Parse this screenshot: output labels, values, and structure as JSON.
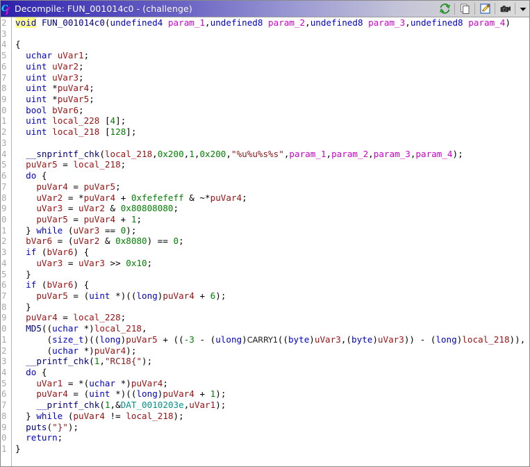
{
  "window": {
    "title": "Decompile: FUN_001014c0 - (challenge)",
    "app_icon": "ghidra-function-icon"
  },
  "toolbar": {
    "buttons": [
      {
        "name": "refresh-button",
        "icon": "refresh-icon",
        "tooltip": "Refresh"
      },
      {
        "name": "copy-button",
        "icon": "copy-icon",
        "tooltip": "Copy"
      },
      {
        "name": "edit-button",
        "icon": "edit-pencil-icon",
        "tooltip": "Edit"
      },
      {
        "name": "snapshot-button",
        "icon": "camera-icon",
        "tooltip": "Snapshot"
      },
      {
        "name": "overflow-button",
        "icon": "chevron-down-icon",
        "tooltip": "More"
      }
    ]
  },
  "colors": {
    "keyword": "#0000c8",
    "function": "#00007f",
    "variable": "#9b1010",
    "parameter": "#cc00cc",
    "number": "#008000",
    "string": "#8b1a1a",
    "data_label": "#00918c",
    "gutter_text": "#a8a8a8",
    "highlight": "#ffff8c",
    "caret": "#e00000",
    "titlebar_start": "#2b1fa8",
    "titlebar_end": "#dcdcdc"
  },
  "editor": {
    "first_line_number": 2,
    "line_count": 41,
    "gutter_digits_visible": 1,
    "line_numbers": [
      "2",
      "3",
      "4",
      "5",
      "6",
      "7",
      "8",
      "9",
      "0",
      "1",
      "2",
      "3",
      "4",
      "5",
      "6",
      "7",
      "8",
      "9",
      "0",
      "1",
      "2",
      "3",
      "4",
      "5",
      "6",
      "7",
      "8",
      "9",
      "0",
      "1",
      "2",
      "3",
      "4",
      "5",
      "6",
      "7",
      "8",
      "9",
      "0",
      "1",
      ""
    ],
    "code_lines": [
      "void FUN_001014c0(undefined4 param_1,undefined8 param_2,undefined8 param_3,undefined8 param_4)",
      "",
      "{",
      "  uchar uVar1;",
      "  uint uVar2;",
      "  uint uVar3;",
      "  uint *puVar4;",
      "  uint *puVar5;",
      "  bool bVar6;",
      "  uint local_228 [4];",
      "  uint local_218 [128];",
      "",
      "  __snprintf_chk(local_218,0x200,1,0x200,\"%u%u%s%s\",param_1,param_2,param_3,param_4);",
      "  puVar5 = local_218;",
      "  do {",
      "    puVar4 = puVar5;",
      "    uVar2 = *puVar4 + 0xfefefeff & ~*puVar4;",
      "    uVar3 = uVar2 & 0x80808080;",
      "    puVar5 = puVar4 + 1;",
      "  } while (uVar3 == 0);",
      "  bVar6 = (uVar2 & 0x8080) == 0;",
      "  if (bVar6) {",
      "    uVar3 = uVar3 >> 0x10;",
      "  }",
      "  if (bVar6) {",
      "    puVar5 = (uint *)((long)puVar4 + 6);",
      "  }",
      "  puVar4 = local_228;",
      "  MD5((uchar *)local_218,",
      "      (size_t)((long)puVar5 + ((-3 - (ulong)CARRY1((byte)uVar3,(byte)uVar3)) - (long)local_218)),",
      "      (uchar *)puVar4);",
      "  __printf_chk(1,\"RC18{\");",
      "  do {",
      "    uVar1 = *(uchar *)puVar4;",
      "    puVar4 = (uint *)((long)puVar4 + 1);",
      "    __printf_chk(1,&DAT_0010203e,uVar1);",
      "  } while (puVar4 != local_218);",
      "  puts(\"}\");",
      "  return;",
      "}"
    ]
  }
}
